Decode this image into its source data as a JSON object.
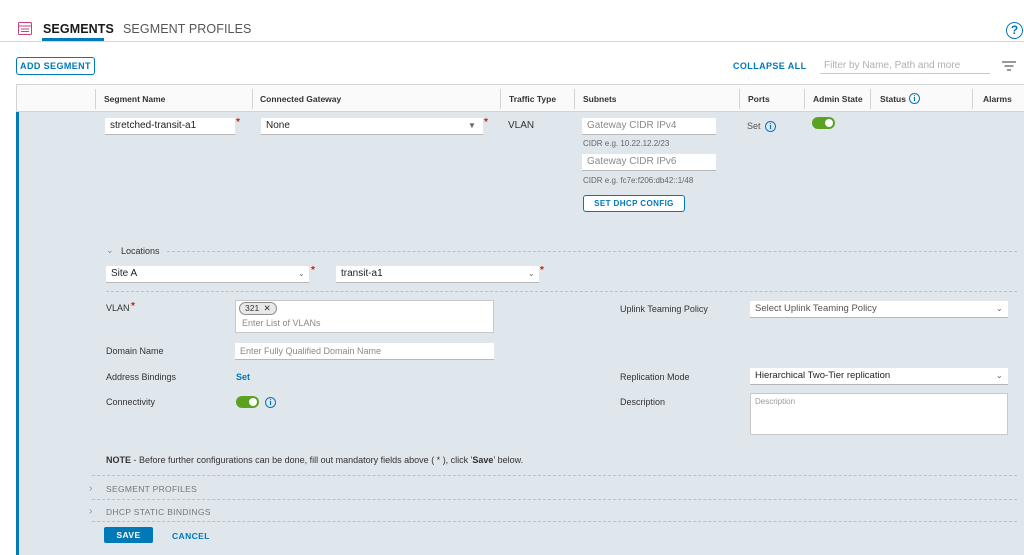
{
  "tabs": {
    "segments": "SEGMENTS",
    "segment_profiles": "SEGMENT PROFILES",
    "help": "?"
  },
  "toolbar": {
    "add_segment": "ADD SEGMENT",
    "collapse_all": "COLLAPSE ALL",
    "filter_placeholder": "Filter by Name, Path and more"
  },
  "table": {
    "columns": {
      "segment_name": "Segment Name",
      "connected_gateway": "Connected Gateway",
      "traffic_type": "Traffic Type",
      "subnets": "Subnets",
      "ports": "Ports",
      "admin_state": "Admin State",
      "status": "Status",
      "alarms": "Alarms"
    }
  },
  "row": {
    "segment_name": "stretched-transit-a1",
    "connected_gateway": "None",
    "traffic_type": "VLAN",
    "gateway_ipv4_placeholder": "Gateway CIDR IPv4",
    "ipv4_hint": "CIDR e.g. 10.22.12.2/23",
    "gateway_ipv6_placeholder": "Gateway CIDR IPv6",
    "ipv6_hint": "CIDR e.g. fc7e:f206:db42::1/48",
    "set_dhcp_config": "SET DHCP CONFIG",
    "ports_set": "Set",
    "admin_state_on": true
  },
  "locations": {
    "label": "Locations",
    "site": "Site A",
    "transit": "transit-a1"
  },
  "form": {
    "vlan_label": "VLAN",
    "vlan_chip": "321",
    "vlan_placeholder": "Enter List of VLANs",
    "domain_label": "Domain Name",
    "domain_placeholder": "Enter Fully Qualified Domain Name",
    "address_bindings_label": "Address Bindings",
    "address_bindings_link": "Set",
    "connectivity_label": "Connectivity",
    "uplink_label": "Uplink Teaming Policy",
    "uplink_placeholder": "Select Uplink Teaming Policy",
    "replication_label": "Replication Mode",
    "replication_value": "Hierarchical Two-Tier replication",
    "description_label": "Description",
    "description_placeholder": "Description"
  },
  "note": {
    "prefix": "NOTE",
    "text_1": " - Before further configurations can be done, fill out mandatory fields above ( * ), click '",
    "save_word": "Save",
    "text_2": "' below."
  },
  "sections": {
    "segment_profiles": "SEGMENT PROFILES",
    "dhcp_static_bindings": "DHCP STATIC BINDINGS"
  },
  "actions": {
    "save": "SAVE",
    "cancel": "CANCEL"
  },
  "colors": {
    "accent": "#0079b8",
    "toggle_on": "#5aa220",
    "panel_bg": "#dfe6ec",
    "required": "#c92100"
  }
}
